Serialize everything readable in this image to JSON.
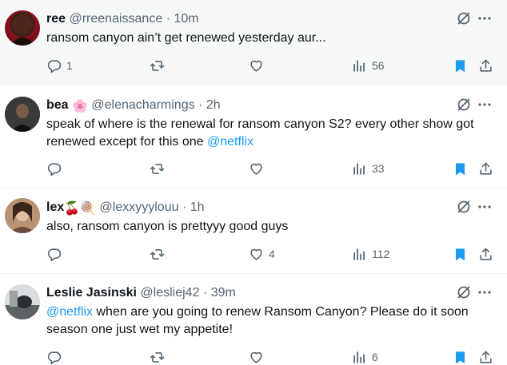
{
  "colors": {
    "accent": "#1d9bf0",
    "text": "#0f1419",
    "muted": "#536471",
    "divider": "#eff3f4"
  },
  "tweets": [
    {
      "name": "ree",
      "emoji": "",
      "handle": "@rreenaissance",
      "sep": "·",
      "time": "10m",
      "text": "ransom canyon ain’t get renewed yesterday aur...",
      "mention": "",
      "replies": "1",
      "retweets": "",
      "likes": "",
      "views": "56",
      "bookmarked": true
    },
    {
      "name": "bea",
      "emoji": "🌸",
      "handle": "@elenacharmings",
      "sep": "·",
      "time": "2h",
      "text": "speak of where is the renewal for ransom canyon S2? every other show got renewed except for this one",
      "mention": "@netflix",
      "replies": "",
      "retweets": "",
      "likes": "",
      "views": "33",
      "bookmarked": true
    },
    {
      "name": "lex",
      "emoji": "🍒🍭",
      "handle": "@lexxyyylouu",
      "sep": "·",
      "time": "1h",
      "text": "also, ransom canyon is prettyyy good guys",
      "mention": "",
      "replies": "",
      "retweets": "",
      "likes": "4",
      "views": "112",
      "bookmarked": true
    },
    {
      "name": "Leslie Jasinski",
      "emoji": "",
      "handle": "@lesliej42",
      "sep": "·",
      "time": "39m",
      "mention": "@netflix",
      "text": " when are you going to renew Ransom Canyon? Please do it soon season one just wet my appetite!",
      "replies": "",
      "retweets": "",
      "likes": "",
      "views": "6",
      "bookmarked": true
    }
  ],
  "icons": {
    "reply": "reply-icon",
    "retweet": "retweet-icon",
    "like": "heart-icon",
    "views": "views-icon",
    "bookmark": "bookmark-icon",
    "share": "share-icon",
    "grok": "grok-icon",
    "more": "more-icon"
  }
}
